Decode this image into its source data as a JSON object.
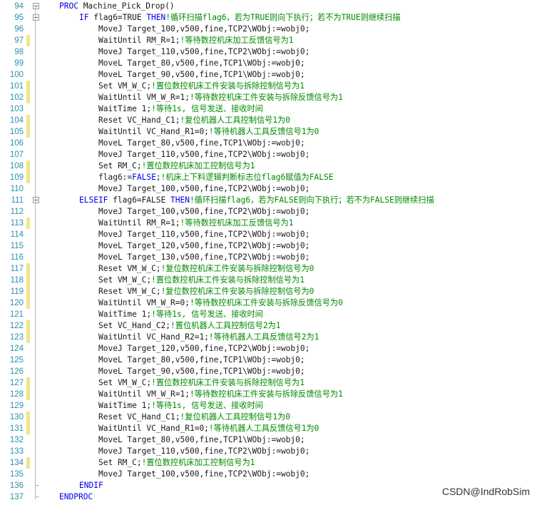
{
  "editor": {
    "lines": [
      {
        "n": "94",
        "segs": [
          [
            "kw",
            "PROC "
          ],
          [
            "",
            "Machine_Pick_Drop()"
          ]
        ]
      },
      {
        "n": "95",
        "segs": [
          [
            "kw",
            "IF "
          ],
          [
            "",
            "flag6=TRUE "
          ],
          [
            "kw",
            "THEN"
          ],
          [
            "cm",
            "!循环扫描flag6，若为TRUE则向下执行；若不为TRUE则继续扫描"
          ]
        ]
      },
      {
        "n": "96",
        "segs": [
          [
            "",
            "MoveJ Target_100,v500,fine,TCP2\\WObj:=wobj0;"
          ]
        ]
      },
      {
        "n": "97",
        "segs": [
          [
            "",
            "WaitUntil RM_R=1;"
          ],
          [
            "cm",
            "!等待数控机床加工反馈信号为1"
          ]
        ]
      },
      {
        "n": "98",
        "segs": [
          [
            "",
            "MoveJ Target_110,v500,fine,TCP2\\WObj:=wobj0;"
          ]
        ]
      },
      {
        "n": "99",
        "segs": [
          [
            "",
            "MoveL Target_80,v500,fine,TCP1\\WObj:=wobj0;"
          ]
        ]
      },
      {
        "n": "100",
        "segs": [
          [
            "",
            "MoveL Target_90,v500,fine,TCP1\\WObj:=wobj0;"
          ]
        ]
      },
      {
        "n": "101",
        "segs": [
          [
            "",
            "Set VM_W_C;"
          ],
          [
            "cm",
            "!置位数控机床工件安装与拆除控制信号为1"
          ]
        ]
      },
      {
        "n": "102",
        "segs": [
          [
            "",
            "WaitUntil VM_W_R=1;"
          ],
          [
            "cm",
            "!等待数控机床工件安装与拆除反馈信号为1"
          ]
        ]
      },
      {
        "n": "103",
        "segs": [
          [
            "",
            "WaitTime 1;"
          ],
          [
            "cm",
            "!等待1s, 信号发送、接收时间"
          ]
        ]
      },
      {
        "n": "104",
        "segs": [
          [
            "",
            "Reset VC_Hand_C1;"
          ],
          [
            "cm",
            "!复位机器人工具控制信号1为0"
          ]
        ]
      },
      {
        "n": "105",
        "segs": [
          [
            "",
            "WaitUntil VC_Hand_R1=0;"
          ],
          [
            "cm",
            "!等待机器人工具反馈信号1为0"
          ]
        ]
      },
      {
        "n": "106",
        "segs": [
          [
            "",
            "MoveL Target_80,v500,fine,TCP1\\WObj:=wobj0;"
          ]
        ]
      },
      {
        "n": "107",
        "segs": [
          [
            "",
            "MoveJ Target_110,v500,fine,TCP2\\WObj:=wobj0;"
          ]
        ]
      },
      {
        "n": "108",
        "segs": [
          [
            "",
            "Set RM_C;"
          ],
          [
            "cm",
            "!置位数控机床加工控制信号为1"
          ]
        ]
      },
      {
        "n": "109",
        "segs": [
          [
            "",
            "flag6:="
          ],
          [
            "kw",
            "FALSE"
          ],
          [
            "",
            ";"
          ],
          [
            "cm",
            "!机床上下料逻辑判断标志位flag6赋值为FALSE"
          ]
        ]
      },
      {
        "n": "110",
        "segs": [
          [
            "",
            "MoveJ Target_100,v500,fine,TCP2\\WObj:=wobj0;"
          ]
        ]
      },
      {
        "n": "111",
        "segs": [
          [
            "kw",
            "ELSEIF "
          ],
          [
            "",
            "flag6=FALSE "
          ],
          [
            "kw",
            "THEN"
          ],
          [
            "cm",
            "!循环扫描flag6，若为FALSE则向下执行；若不为FALSE则继续扫描"
          ]
        ]
      },
      {
        "n": "112",
        "segs": [
          [
            "",
            "MoveJ Target_100,v500,fine,TCP2\\WObj:=wobj0;"
          ]
        ]
      },
      {
        "n": "113",
        "segs": [
          [
            "",
            "WaitUntil RM_R=1;"
          ],
          [
            "cm",
            "!等待数控机床加工反馈信号为1"
          ]
        ]
      },
      {
        "n": "114",
        "segs": [
          [
            "",
            "MoveJ Target_110,v500,fine,TCP2\\WObj:=wobj0;"
          ]
        ]
      },
      {
        "n": "115",
        "segs": [
          [
            "",
            "MoveL Target_120,v500,fine,TCP2\\WObj:=wobj0;"
          ]
        ]
      },
      {
        "n": "116",
        "segs": [
          [
            "",
            "MoveL Target_130,v500,fine,TCP2\\WObj:=wobj0;"
          ]
        ]
      },
      {
        "n": "117",
        "segs": [
          [
            "",
            "Reset VM_W_C;"
          ],
          [
            "cm",
            "!复位数控机床工件安装与拆除控制信号为0"
          ]
        ]
      },
      {
        "n": "118",
        "segs": [
          [
            "",
            "Set VM_W_C;"
          ],
          [
            "cm",
            "!置位数控机床工件安装与拆除控制信号为1"
          ]
        ]
      },
      {
        "n": "119",
        "segs": [
          [
            "",
            "Reset VM_W_C;"
          ],
          [
            "cm",
            "!复位数控机床工件安装与拆除控制信号为0"
          ]
        ]
      },
      {
        "n": "120",
        "segs": [
          [
            "",
            "WaitUntil VM_W_R=0;"
          ],
          [
            "cm",
            "!等待数控机床工件安装与拆除反馈信号为0"
          ]
        ]
      },
      {
        "n": "121",
        "segs": [
          [
            "",
            "WaitTime 1;"
          ],
          [
            "cm",
            "!等待1s, 信号发送、接收时间"
          ]
        ]
      },
      {
        "n": "122",
        "segs": [
          [
            "",
            "Set VC_Hand_C2;"
          ],
          [
            "cm",
            "!置位机器人工具控制信号2为1"
          ]
        ]
      },
      {
        "n": "123",
        "segs": [
          [
            "",
            "WaitUntil VC_Hand_R2=1;"
          ],
          [
            "cm",
            "!等待机器人工具反馈信号2为1"
          ]
        ]
      },
      {
        "n": "124",
        "segs": [
          [
            "",
            "MoveJ Target_120,v500,fine,TCP2\\WObj:=wobj0;"
          ]
        ]
      },
      {
        "n": "125",
        "segs": [
          [
            "",
            "MoveL Target_80,v500,fine,TCP1\\WObj:=wobj0;"
          ]
        ]
      },
      {
        "n": "126",
        "segs": [
          [
            "",
            "MoveL Target_90,v500,fine,TCP1\\WObj:=wobj0;"
          ]
        ]
      },
      {
        "n": "127",
        "segs": [
          [
            "",
            "Set VM_W_C;"
          ],
          [
            "cm",
            "!置位数控机床工件安装与拆除控制信号为1"
          ]
        ]
      },
      {
        "n": "128",
        "segs": [
          [
            "",
            "WaitUntil VM_W_R=1;"
          ],
          [
            "cm",
            "!等待数控机床工件安装与拆除反馈信号为1"
          ]
        ]
      },
      {
        "n": "129",
        "segs": [
          [
            "",
            "WaitTime 1;"
          ],
          [
            "cm",
            "!等待1s, 信号发送、接收时间"
          ]
        ]
      },
      {
        "n": "130",
        "segs": [
          [
            "",
            "Reset VC_Hand_C1;"
          ],
          [
            "cm",
            "!复位机器人工具控制信号1为0"
          ]
        ]
      },
      {
        "n": "131",
        "segs": [
          [
            "",
            "WaitUntil VC_Hand_R1=0;"
          ],
          [
            "cm",
            "!等待机器人工具反馈信号1为0"
          ]
        ]
      },
      {
        "n": "132",
        "segs": [
          [
            "",
            "MoveL Target_80,v500,fine,TCP1\\WObj:=wobj0;"
          ]
        ]
      },
      {
        "n": "133",
        "segs": [
          [
            "",
            "MoveJ Target_110,v500,fine,TCP2\\WObj:=wobj0;"
          ]
        ]
      },
      {
        "n": "134",
        "segs": [
          [
            "",
            "Set RM_C;"
          ],
          [
            "cm",
            "!置位数控机床加工控制信号为1"
          ]
        ]
      },
      {
        "n": "135",
        "segs": [
          [
            "",
            "MoveJ Target_100,v500,fine,TCP2\\WObj:=wobj0;"
          ]
        ]
      },
      {
        "n": "136",
        "segs": [
          [
            "kw",
            "ENDIF"
          ]
        ]
      },
      {
        "n": "137",
        "segs": [
          [
            "kw",
            "ENDPROC"
          ]
        ]
      }
    ]
  },
  "change_marks": [
    "97",
    "101",
    "102",
    "104",
    "105",
    "108",
    "109",
    "113",
    "117",
    "118",
    "119",
    "120",
    "122",
    "123",
    "127",
    "128",
    "130",
    "131",
    "134"
  ],
  "fold_markers": [
    "94",
    "95",
    "111"
  ],
  "colors": {
    "line_number": "#2a91af",
    "keyword": "#0000e6",
    "comment": "#008a00",
    "change_mark": "#f0e68a"
  },
  "watermark": "CSDN@IndRobSim"
}
